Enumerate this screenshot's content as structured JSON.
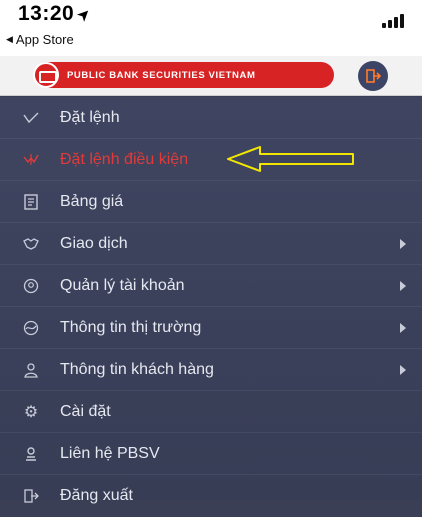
{
  "status_bar": {
    "time": "13:20",
    "back_label": "App Store"
  },
  "header": {
    "brand": "PUBLIC BANK SECURITIES VIETNAM"
  },
  "menu": {
    "items": [
      {
        "label": "Đặt lệnh",
        "icon": "order-icon",
        "submenu": false,
        "active": false
      },
      {
        "label": "Đặt lệnh điều kiện",
        "icon": "conditional-order-icon",
        "submenu": false,
        "active": true
      },
      {
        "label": "Bảng giá",
        "icon": "price-board-icon",
        "submenu": false,
        "active": false
      },
      {
        "label": "Giao dịch",
        "icon": "handshake-icon",
        "submenu": true,
        "active": false
      },
      {
        "label": "Quản lý tài khoản",
        "icon": "account-icon",
        "submenu": true,
        "active": false
      },
      {
        "label": "Thông tin thị trường",
        "icon": "market-icon",
        "submenu": true,
        "active": false
      },
      {
        "label": "Thông tin khách hàng",
        "icon": "customer-icon",
        "submenu": true,
        "active": false
      },
      {
        "label": "Cài đặt",
        "icon": "gear-icon",
        "submenu": false,
        "active": false
      },
      {
        "label": "Liên hệ PBSV",
        "icon": "contact-icon",
        "submenu": false,
        "active": false
      },
      {
        "label": "Đăng xuất",
        "icon": "logout-icon",
        "submenu": false,
        "active": false
      }
    ]
  },
  "colors": {
    "menu_bg": "#3d4360",
    "active_text": "#e23a3a",
    "brand_red": "#d82325",
    "annotation_arrow": "#f2e600"
  }
}
